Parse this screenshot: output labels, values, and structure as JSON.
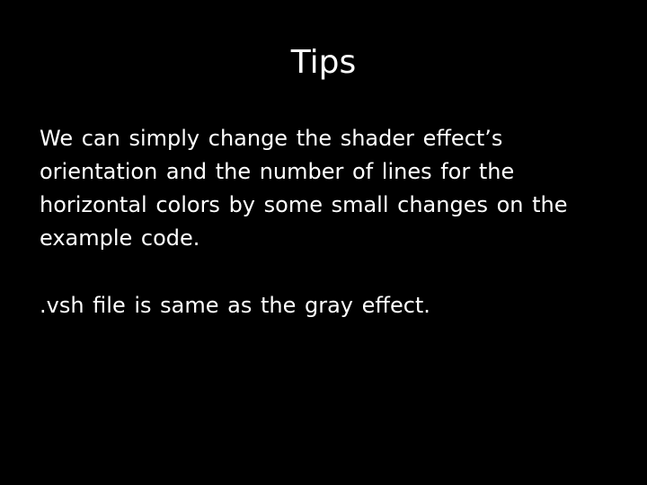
{
  "slide": {
    "title": "Tips",
    "paragraphs": [
      "We can simply change the shader effect’s orientation and the number of lines for the horizontal colors by some small changes on the example code.",
      ".vsh file is same as the gray effect."
    ],
    "colors": {
      "background": "#000000",
      "text": "#ffffff"
    }
  }
}
